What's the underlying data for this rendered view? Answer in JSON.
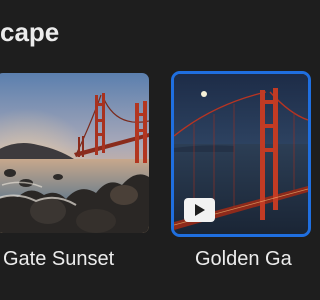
{
  "section": {
    "title": "cape"
  },
  "tiles": [
    {
      "title": "Gate Sunset",
      "selected": false,
      "icon": "bridge-photo-thumbnail"
    },
    {
      "title": "Golden Ga",
      "selected": true,
      "badge_icon": "play-icon",
      "icon": "bridge-night-thumbnail"
    }
  ],
  "colors": {
    "background": "#1e1e1e",
    "selection": "#1f6fe0",
    "text": "#ececec"
  }
}
